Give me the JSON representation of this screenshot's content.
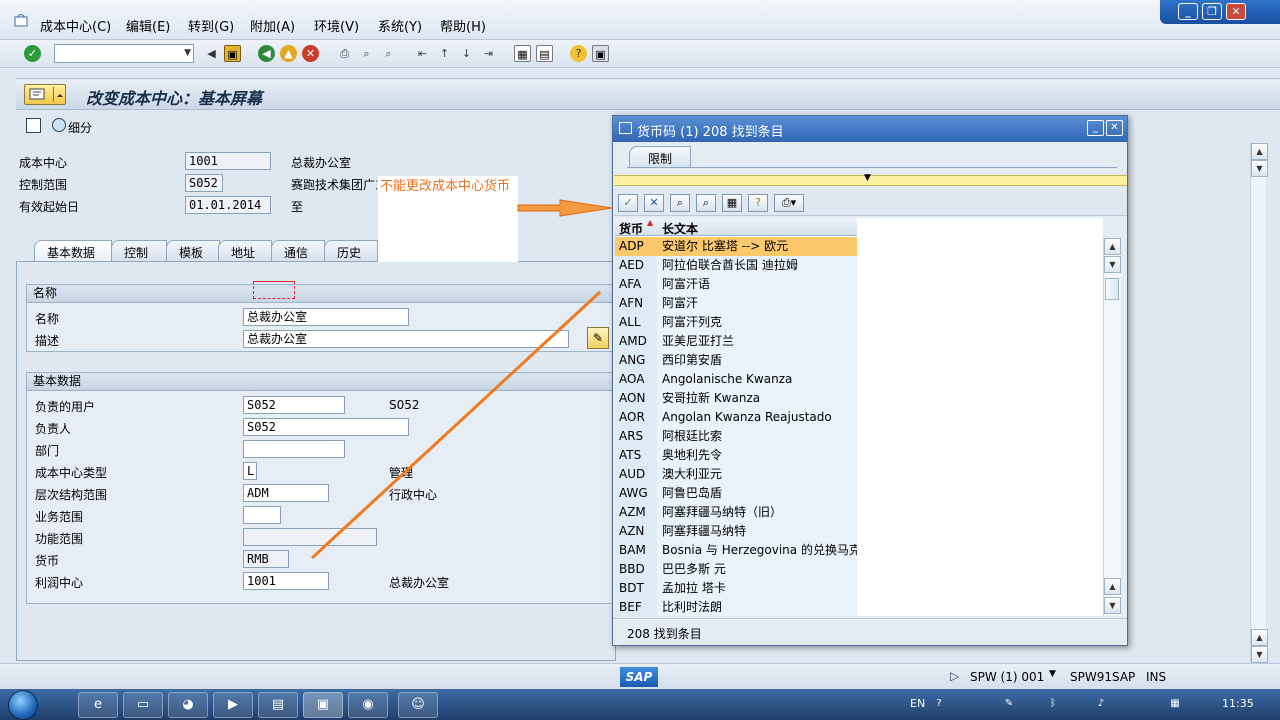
{
  "menu": [
    "成本中心(C)",
    "编辑(E)",
    "转到(G)",
    "附加(A)",
    "环境(V)",
    "系统(Y)",
    "帮助(H)"
  ],
  "page_title": "改变成本中心：基本屏幕",
  "detail_button_label": "细分",
  "header_fields": {
    "cost_center_label": "成本中心",
    "cost_center_value": "1001",
    "cost_center_text": "总裁办公室",
    "controlling_area_label": "控制范围",
    "controlling_area_value": "S052",
    "controlling_area_text": "赛跑技术集团广东",
    "valid_from_label": "有效起始日",
    "valid_from_value": "01.01.2014",
    "valid_to_label": "至"
  },
  "tabs": [
    "基本数据",
    "控制",
    "模板",
    "地址",
    "通信",
    "历史"
  ],
  "names_group": {
    "title": "名称",
    "name_label": "名称",
    "name_value": "总裁办公室",
    "desc_label": "描述",
    "desc_value": "总裁办公室"
  },
  "basic_group": {
    "title": "基本数据",
    "user_label": "负责的用户",
    "user_value": "S052",
    "user_text": "S052",
    "person_label": "负责人",
    "person_value": "S052",
    "dept_label": "部门",
    "dept_value": "",
    "type_label": "成本中心类型",
    "type_value": "L",
    "type_text": "管理",
    "hier_label": "层次结构范围",
    "hier_value": "ADM",
    "hier_text": "行政中心",
    "business_label": "业务范围",
    "business_value": "",
    "function_label": "功能范围",
    "function_value": "",
    "currency_label": "货币",
    "currency_value": "RMB",
    "profit_label": "利润中心",
    "profit_value": "1001",
    "profit_text": "总裁办公室"
  },
  "annotation": "不能更改成本中心货币",
  "popup": {
    "title": "货币码 (1)  208 找到条目",
    "restrict_tab": "限制",
    "col_code": "货币",
    "col_text": "长文本",
    "rows": [
      {
        "code": "ADP",
        "text": "安道尔 比塞塔 --> 欧元"
      },
      {
        "code": "AED",
        "text": "阿拉伯联合酋长国 迪拉姆"
      },
      {
        "code": "AFA",
        "text": "阿富汗语"
      },
      {
        "code": "AFN",
        "text": "阿富汗"
      },
      {
        "code": "ALL",
        "text": "阿富汗列克"
      },
      {
        "code": "AMD",
        "text": "亚美尼亚打兰"
      },
      {
        "code": "ANG",
        "text": "西印第安盾"
      },
      {
        "code": "AOA",
        "text": "Angolanische Kwanza"
      },
      {
        "code": "AON",
        "text": "安哥拉新 Kwanza"
      },
      {
        "code": "AOR",
        "text": "Angolan Kwanza Reajustado"
      },
      {
        "code": "ARS",
        "text": "阿根廷比索"
      },
      {
        "code": "ATS",
        "text": "奥地利先令"
      },
      {
        "code": "AUD",
        "text": "澳大利亚元"
      },
      {
        "code": "AWG",
        "text": "阿鲁巴岛盾"
      },
      {
        "code": "AZM",
        "text": "阿塞拜疆马纳特（旧）"
      },
      {
        "code": "AZN",
        "text": "阿塞拜疆马纳特"
      },
      {
        "code": "BAM",
        "text": "Bosnia 与 Herzegovina 的兑换马克"
      },
      {
        "code": "BBD",
        "text": "巴巴多斯 元"
      },
      {
        "code": "BDT",
        "text": "孟加拉 塔卡"
      },
      {
        "code": "BEF",
        "text": "比利时法朗"
      }
    ],
    "status": "208 找到条目"
  },
  "statusbar": {
    "system": "SPW (1) 001",
    "server": "SPW91SAP",
    "mode": "INS",
    "logo": "SAP"
  },
  "taskbar": {
    "lang": "EN",
    "clock": "11:35"
  }
}
